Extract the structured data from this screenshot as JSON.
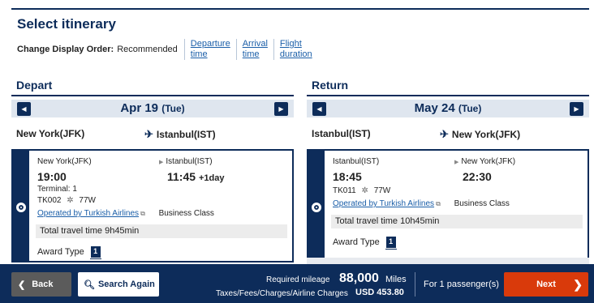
{
  "page": {
    "title": "Select itinerary",
    "order_label": "Change Display Order:",
    "order_current": "Recommended",
    "order_links": [
      {
        "line1": "Departure",
        "line2": "time"
      },
      {
        "line1": "Arrival",
        "line2": "time"
      },
      {
        "line1": "Flight",
        "line2": "duration"
      }
    ]
  },
  "depart": {
    "section_title": "Depart",
    "date": "Apr 19",
    "dow": "(Tue)",
    "from": "New York(JFK)",
    "to": "Istanbul(IST)",
    "flight": {
      "dep_airport": "New York(JFK)",
      "arr_airport": "Istanbul(IST)",
      "dep_time": "19:00",
      "arr_time": "11:45",
      "arr_nextday": "+1day",
      "terminal": "Terminal: 1",
      "flight_no": "TK002",
      "aircraft": "77W",
      "operated_by": "Operated by Turkish Airlines",
      "cabin": "Business Class",
      "travel_time": "Total travel time 9h45min",
      "award_label": "Award Type",
      "award_value": "1"
    }
  },
  "return": {
    "section_title": "Return",
    "date": "May 24",
    "dow": "(Tue)",
    "from": "Istanbul(IST)",
    "to": "New York(JFK)",
    "flight": {
      "dep_airport": "Istanbul(IST)",
      "arr_airport": "New York(JFK)",
      "dep_time": "18:45",
      "arr_time": "22:30",
      "flight_no": "TK011",
      "aircraft": "77W",
      "operated_by": "Operated by Turkish Airlines",
      "cabin": "Business Class",
      "travel_time": "Total travel time 10h45min",
      "award_label": "Award Type",
      "award_value": "1"
    }
  },
  "footer": {
    "back_label": "Back",
    "search_label": "Search Again",
    "mileage_label": "Required mileage",
    "mileage_value": "88,000",
    "mileage_unit": "Miles",
    "taxes_label": "Taxes/Fees/Charges/Airline Charges",
    "taxes_value": "USD 453.80",
    "passengers": "For 1 passenger(s)",
    "next_label": "Next"
  },
  "icons": {
    "prev": "chevron-left-icon",
    "next": "chevron-right-icon",
    "plane": "airplane-icon",
    "star": "star-alliance-icon",
    "external": "external-link-icon",
    "search": "search-icon"
  },
  "colors": {
    "navy": "#0d2c5a",
    "link": "#1a5ea8",
    "next_button": "#d93a0b",
    "back_button": "#5b5b5b"
  }
}
